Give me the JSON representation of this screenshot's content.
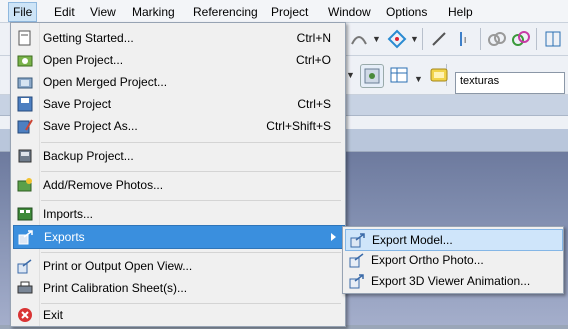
{
  "menubar": {
    "items": [
      "File",
      "Edit",
      "View",
      "Marking",
      "Referencing",
      "Project",
      "Window",
      "Options",
      "Help"
    ],
    "active": "File"
  },
  "toolbar": {
    "texturas_label": "texturas"
  },
  "file_menu": {
    "items": [
      {
        "label": "Getting Started...",
        "shortcut": "Ctrl+N",
        "icon": "getting-started-icon"
      },
      {
        "label": "Open Project...",
        "shortcut": "Ctrl+O",
        "icon": "open-project-icon"
      },
      {
        "label": "Open Merged Project...",
        "shortcut": "",
        "icon": "open-merged-icon"
      },
      {
        "label": "Save Project",
        "shortcut": "Ctrl+S",
        "icon": "save-icon"
      },
      {
        "label": "Save Project As...",
        "shortcut": "Ctrl+Shift+S",
        "icon": "save-as-icon"
      },
      {
        "label": "Backup Project...",
        "shortcut": "",
        "icon": "backup-icon"
      },
      {
        "label": "Add/Remove Photos...",
        "shortcut": "",
        "icon": "photos-icon"
      },
      {
        "label": "Imports...",
        "shortcut": "",
        "icon": "imports-icon"
      },
      {
        "label": "Exports",
        "shortcut": "",
        "icon": "exports-icon"
      },
      {
        "label": "Print or Output Open View...",
        "shortcut": "",
        "icon": "print-view-icon"
      },
      {
        "label": "Print Calibration Sheet(s)...",
        "shortcut": "",
        "icon": "printer-icon"
      },
      {
        "label": "Exit",
        "shortcut": "",
        "icon": "exit-icon"
      }
    ]
  },
  "exports_submenu": {
    "items": [
      {
        "label": "Export Model...",
        "icon": "export-model-icon"
      },
      {
        "label": "Export Ortho Photo...",
        "icon": "export-ortho-icon"
      },
      {
        "label": "Export 3D Viewer Animation...",
        "icon": "export-animation-icon"
      }
    ]
  }
}
